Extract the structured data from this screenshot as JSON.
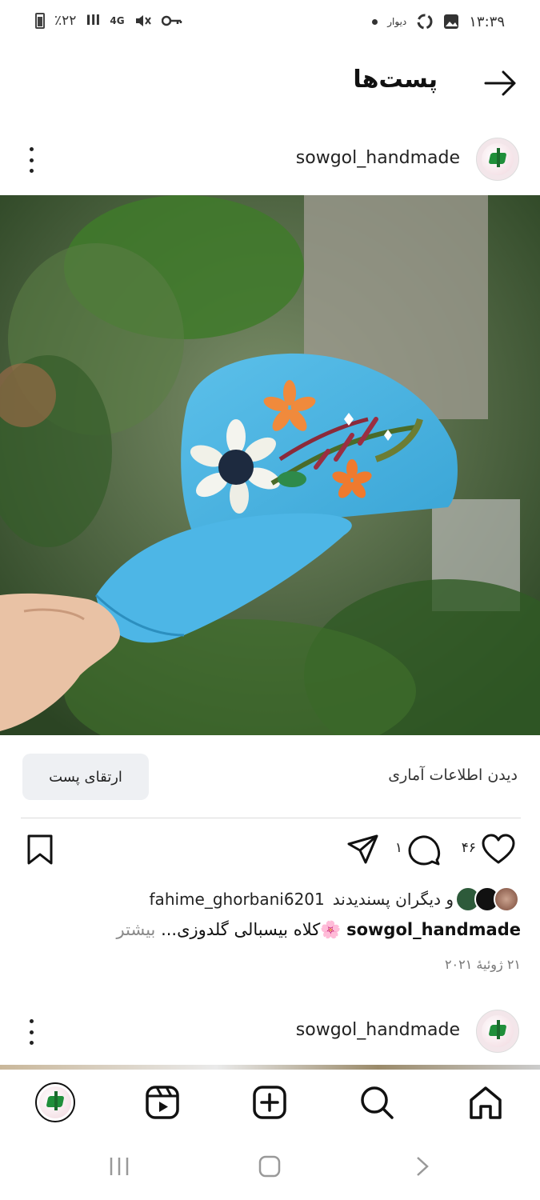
{
  "status_bar": {
    "time": "۱۳:۳۹",
    "carrier_label": "دیوار",
    "signal": "Ill",
    "network": "4G",
    "battery_text": "٪۲۲"
  },
  "header": {
    "title": "پست‌ها"
  },
  "post": {
    "username": "sowgol_handmade",
    "insights_label": "دیدن اطلاعات آماری",
    "boost_label": "ارتقای پست",
    "like_count": "۴۶",
    "comment_count": "۱",
    "liked_by_user": "fahime_ghorbani6201",
    "liked_by_suffix": "و دیگران پسندیدند",
    "caption_username": "sowgol_handmade",
    "caption_text": "🌸کلاه بیسبالی گلدوزی...",
    "caption_more": "بیشتر",
    "date": "۲۱ ژوئیهٔ ۲۰۲۱"
  },
  "next_post": {
    "username": "sowgol_handmade"
  },
  "bottom_nav": [
    "profile-tab",
    "reels-tab",
    "create-tab",
    "search-tab",
    "home-tab"
  ],
  "icons": {
    "back": "arrow-right-icon",
    "more": "kebab-icon",
    "like": "heart-icon",
    "comment": "comment-icon",
    "share": "send-icon",
    "save": "bookmark-icon"
  },
  "colors": {
    "accent": "#111111",
    "boost_bg": "#eef0f3",
    "cap": "#4fb3e0"
  }
}
